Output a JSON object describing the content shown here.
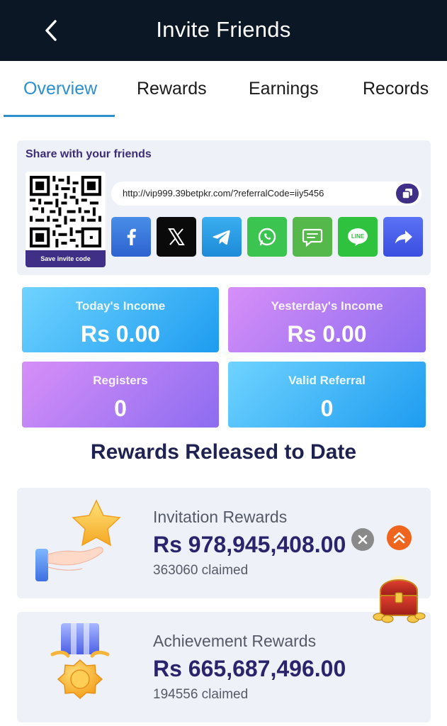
{
  "header": {
    "title": "Invite Friends"
  },
  "tabs": [
    {
      "label": "Overview",
      "active": true
    },
    {
      "label": "Rewards",
      "active": false
    },
    {
      "label": "Earnings",
      "active": false
    },
    {
      "label": "Records",
      "active": false
    }
  ],
  "share": {
    "title": "Share with your friends",
    "save_invite_code": "Save invite code",
    "referral_link": "http://vip999.39betpkr.com/?referralCode=iiy5456",
    "buttons": [
      "facebook-icon",
      "x-icon",
      "telegram-icon",
      "whatsapp-icon",
      "sms-icon",
      "line-icon",
      "share-icon"
    ]
  },
  "stats": {
    "today_income": {
      "label": "Today's Income",
      "value": "Rs 0.00"
    },
    "yesterday_income": {
      "label": "Yesterday's Income",
      "value": "Rs 0.00"
    },
    "registers": {
      "label": "Registers",
      "value": "0"
    },
    "valid_referral": {
      "label": "Valid Referral",
      "value": "0"
    }
  },
  "rewards_section": {
    "title": "Rewards Released to Date",
    "items": [
      {
        "name": "Invitation Rewards",
        "amount": "Rs 978,945,408.00",
        "claimed": "363060 claimed",
        "icon": "star-hand-icon"
      },
      {
        "name": "Achievement Rewards",
        "amount": "Rs 665,687,496.00",
        "claimed": "194556 claimed",
        "icon": "medal-icon"
      }
    ]
  },
  "colors": {
    "header_bg": "#0c1726",
    "accent": "#2b8fd0",
    "brand_purple": "#3f2f86",
    "title_navy": "#1f2251"
  }
}
